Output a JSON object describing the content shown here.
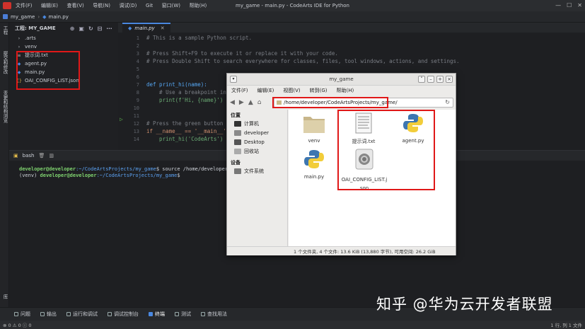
{
  "window": {
    "menu": [
      "文件(F)",
      "编辑(E)",
      "查看(V)",
      "导航(N)",
      "调试(D)",
      "Git",
      "窗口(W)",
      "帮助(H)"
    ],
    "title": "my_game - main.py - CodeArts IDE for Python",
    "buttons": [
      "—",
      "☐",
      "✕"
    ]
  },
  "breadcrumb": {
    "project": "my_game",
    "file": "main.py"
  },
  "activity": {
    "labels": [
      "工程",
      "提交和修改",
      "变更和结构浏览",
      "数据库"
    ]
  },
  "project_panel": {
    "title": "工程: MY_GAME",
    "items": [
      {
        "label": ".arts",
        "icon": "chevron-right-icon"
      },
      {
        "label": "venv",
        "icon": "chevron-right-icon"
      },
      {
        "label": "提示词.txt",
        "icon": "text-file-icon"
      },
      {
        "label": "agent.py",
        "icon": "python-file-icon"
      },
      {
        "label": "main.py",
        "icon": "python-file-icon"
      },
      {
        "label": "OAI_CONFIG_LIST.json",
        "icon": "json-file-icon"
      }
    ]
  },
  "editor": {
    "tab": "main.py",
    "line_numbers": [
      "1",
      "2",
      "3",
      "4",
      "5",
      "6",
      "7",
      "8",
      "9",
      "10",
      "11",
      "12",
      "13",
      "14"
    ],
    "lines": [
      "# This is a sample Python script.",
      "",
      "# Press Shift+F9 to execute it or replace it with your code.",
      "# Press Double Shift to search everywhere for classes, files, tool windows, actions, and settings.",
      "",
      "",
      "def print_hi(name):",
      "    # Use a breakpoint in t",
      "    print(f'Hi, {name}')",
      "",
      "",
      "# Press the green button i",
      "if __name__ == '__main__':",
      "    print_hi('CodeArts')"
    ]
  },
  "terminal": {
    "tab": "bash",
    "line1_user": "developer@developer",
    "line1_path": ":~/CodeArtsProjects/my_game",
    "line1_cmd": "$ source /home/developer/Co",
    "line2_prefix": "(venv) ",
    "line2_user": "developer@developer",
    "line2_path": ":~/CodeArtsProjects/my_game",
    "line2_cmd": "$"
  },
  "bottom_tools": [
    "问题",
    "输出",
    "运行和调试",
    "调试控制台",
    "终端",
    "测试",
    "查找用法"
  ],
  "status": {
    "left": "⊗ 0  ⚠ 0  ⓘ 0",
    "right": "1 行, 列 1  文件"
  },
  "file_manager": {
    "title": "my_game",
    "menu": [
      "文件(F)",
      "编辑(E)",
      "视图(V)",
      "转到(G)",
      "帮助(H)"
    ],
    "address": "/home/developer/CodeArtsProjects/my_game/",
    "sidebar_places_header": "位置",
    "places": [
      "计算机",
      "developer",
      "Desktop",
      "回收站"
    ],
    "sidebar_devices_header": "设备",
    "devices": [
      "文件系统"
    ],
    "files": [
      "venv",
      "提示词.txt",
      "agent.py",
      "main.py",
      "OAI_CONFIG_LIST.json"
    ],
    "statusbar": "1 个文件夹, 4 个文件: 13.6 KiB (13,880 字节), 可用空间: 26.2 GiB"
  },
  "watermark": "知乎 @华为云开发者联盟",
  "colors": {
    "highlight": "#e01818",
    "accent": "#4a88e0"
  }
}
